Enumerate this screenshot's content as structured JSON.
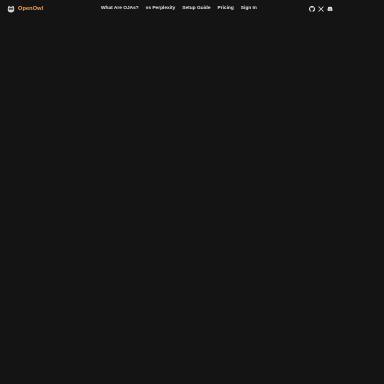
{
  "brand": {
    "name": "OpenOwl",
    "logo_icon": "owl-logo-icon",
    "color": "#f2a65a"
  },
  "nav": {
    "items": [
      {
        "label": "What Are OJAs?"
      },
      {
        "label": "vs Perplexity"
      },
      {
        "label": "Setup Guide"
      },
      {
        "label": "Pricing"
      },
      {
        "label": "Sign In"
      }
    ]
  },
  "social": {
    "icons": [
      "github-icon",
      "x-icon",
      "discord-icon"
    ]
  },
  "colors": {
    "background": "#141415",
    "nav_text": "#e9e9e9"
  }
}
